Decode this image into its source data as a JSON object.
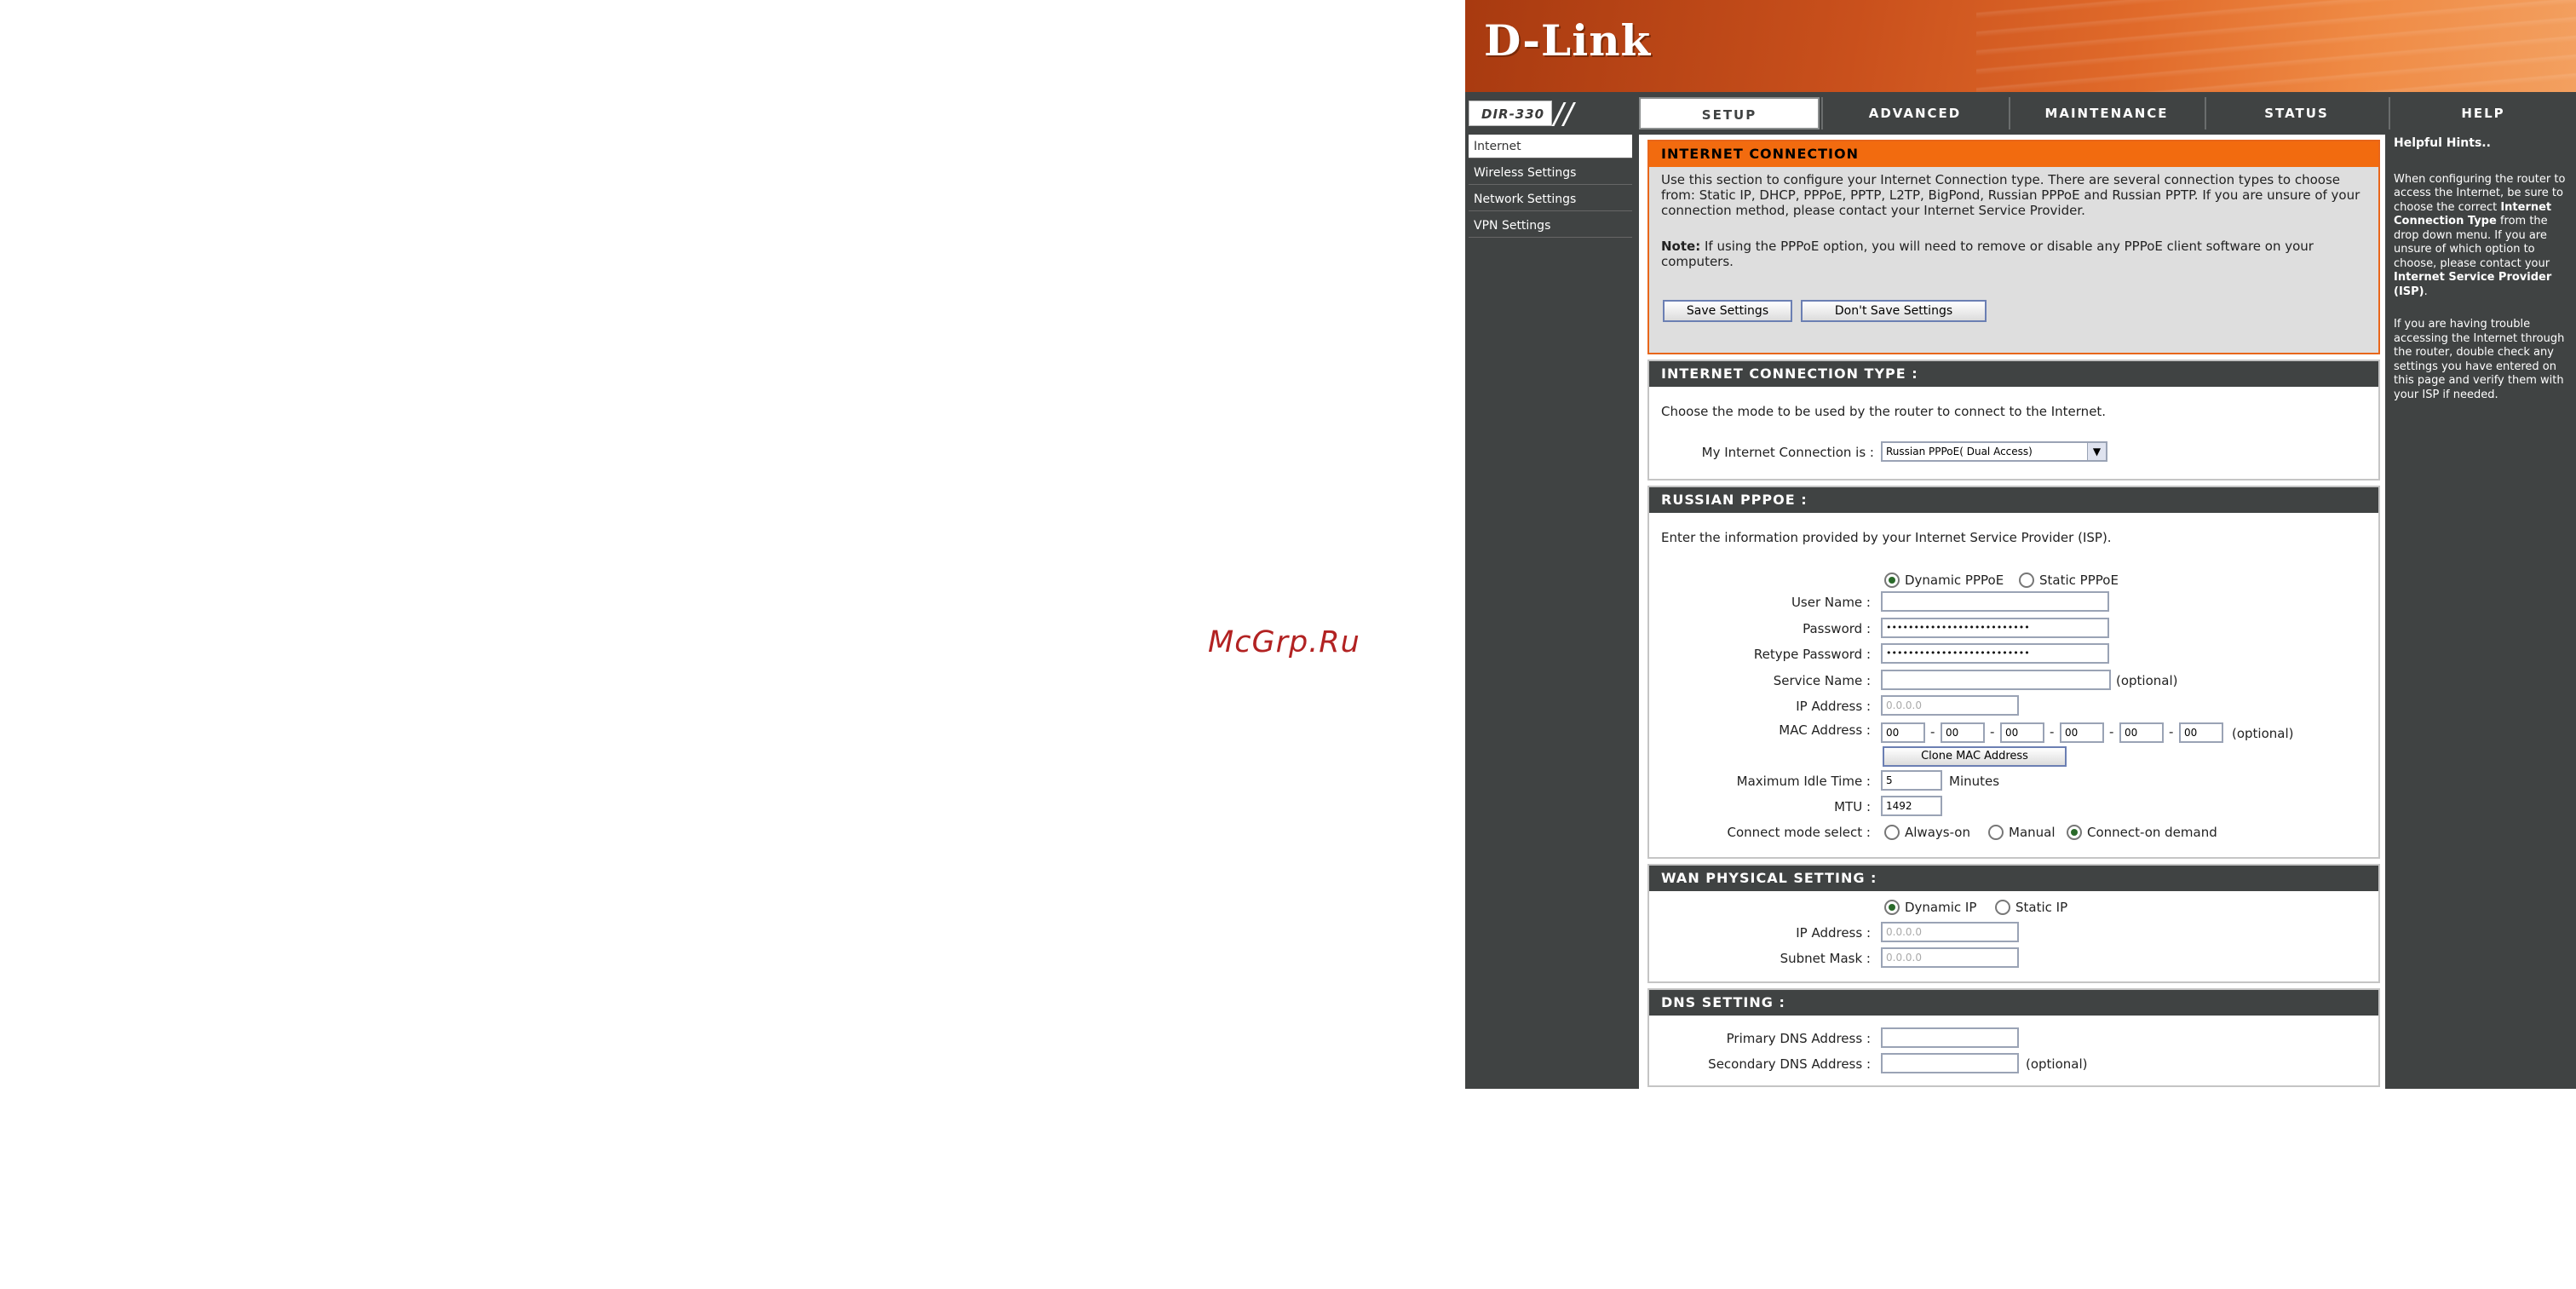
{
  "watermark": "McGrp.Ru",
  "brand": {
    "logo": "D-Link",
    "model": "DIR-330",
    "slashes": "//"
  },
  "tabs": [
    {
      "label": "SETUP",
      "active": true
    },
    {
      "label": "ADVANCED",
      "active": false
    },
    {
      "label": "MAINTENANCE",
      "active": false
    },
    {
      "label": "STATUS",
      "active": false
    },
    {
      "label": "HELP",
      "active": false
    }
  ],
  "sidebar": {
    "items": [
      {
        "label": "Internet",
        "active": true
      },
      {
        "label": "Wireless Settings",
        "active": false
      },
      {
        "label": "Network Settings",
        "active": false
      },
      {
        "label": "VPN Settings",
        "active": false
      }
    ]
  },
  "intro": {
    "title": "INTERNET CONNECTION",
    "text": "Use this section to configure your Internet Connection type. There are several connection types to choose from: Static IP, DHCP, PPPoE, PPTP, L2TP, BigPond, Russian PPPoE and Russian PPTP. If you are unsure of your connection method, please contact your Internet Service Provider.",
    "note_bold": "Note:",
    "note_text": " If using the PPPoE option, you will need to remove or disable any PPPoE client software on your computers.",
    "save_label": "Save Settings",
    "dont_save_label": "Don't Save Settings"
  },
  "conn_type": {
    "title": "INTERNET CONNECTION TYPE :",
    "desc": "Choose the mode to be used by the router to connect to the Internet.",
    "label": "My Internet Connection is :",
    "selected": "Russian PPPoE( Dual Access)",
    "arrow": "▼"
  },
  "pppoe": {
    "title": "RUSSIAN PPPOE :",
    "desc": "Enter the information provided by your Internet Service Provider (ISP).",
    "mode_dynamic": "Dynamic PPPoE",
    "mode_static": "Static PPPoE",
    "mode_selected": "dynamic",
    "user_label": "User Name :",
    "user_value": "",
    "password_label": "Password :",
    "password_value": "••••••••••••••••••••••••••",
    "retype_label": "Retype Password :",
    "retype_value": "••••••••••••••••••••••••••",
    "service_label": "Service Name :",
    "service_value": "",
    "optional": "(optional)",
    "ip_label": "IP Address :",
    "ip_value": "0.0.0.0",
    "mac_label": "MAC Address :",
    "mac_values": [
      "00",
      "00",
      "00",
      "00",
      "00",
      "00"
    ],
    "mac_sep": "-",
    "clone_label": "Clone MAC Address",
    "idle_label": "Maximum Idle Time :",
    "idle_value": "5",
    "idle_unit": "Minutes",
    "mtu_label": "MTU :",
    "mtu_value": "1492",
    "connect_label": "Connect mode select :",
    "connect_always": "Always-on",
    "connect_manual": "Manual",
    "connect_demand": "Connect-on demand",
    "connect_selected": "demand"
  },
  "wan": {
    "title": "WAN PHYSICAL SETTING :",
    "mode_dynamic": "Dynamic IP",
    "mode_static": "Static IP",
    "mode_selected": "dynamic",
    "ip_label": "IP Address :",
    "ip_value": "0.0.0.0",
    "mask_label": "Subnet Mask :",
    "mask_value": "0.0.0.0"
  },
  "dns": {
    "title": "DNS SETTING :",
    "primary_label": "Primary DNS Address :",
    "primary_value": "",
    "secondary_label": "Secondary DNS Address :",
    "secondary_value": "",
    "optional": "(optional)"
  },
  "hints": {
    "title": "Helpful Hints..",
    "p1_a": "When configuring the router to access the Internet, be sure to choose the correct ",
    "p1_b": "Internet Connection Type",
    "p1_c": " from the drop down menu. If you are unsure of which option to choose, please contact your ",
    "p1_d": "Internet Service Provider (ISP)",
    "p1_e": ".",
    "p2": "If you are having trouble accessing the Internet through the router, double check any settings you have entered on this page and verify them with your ISP if needed."
  }
}
